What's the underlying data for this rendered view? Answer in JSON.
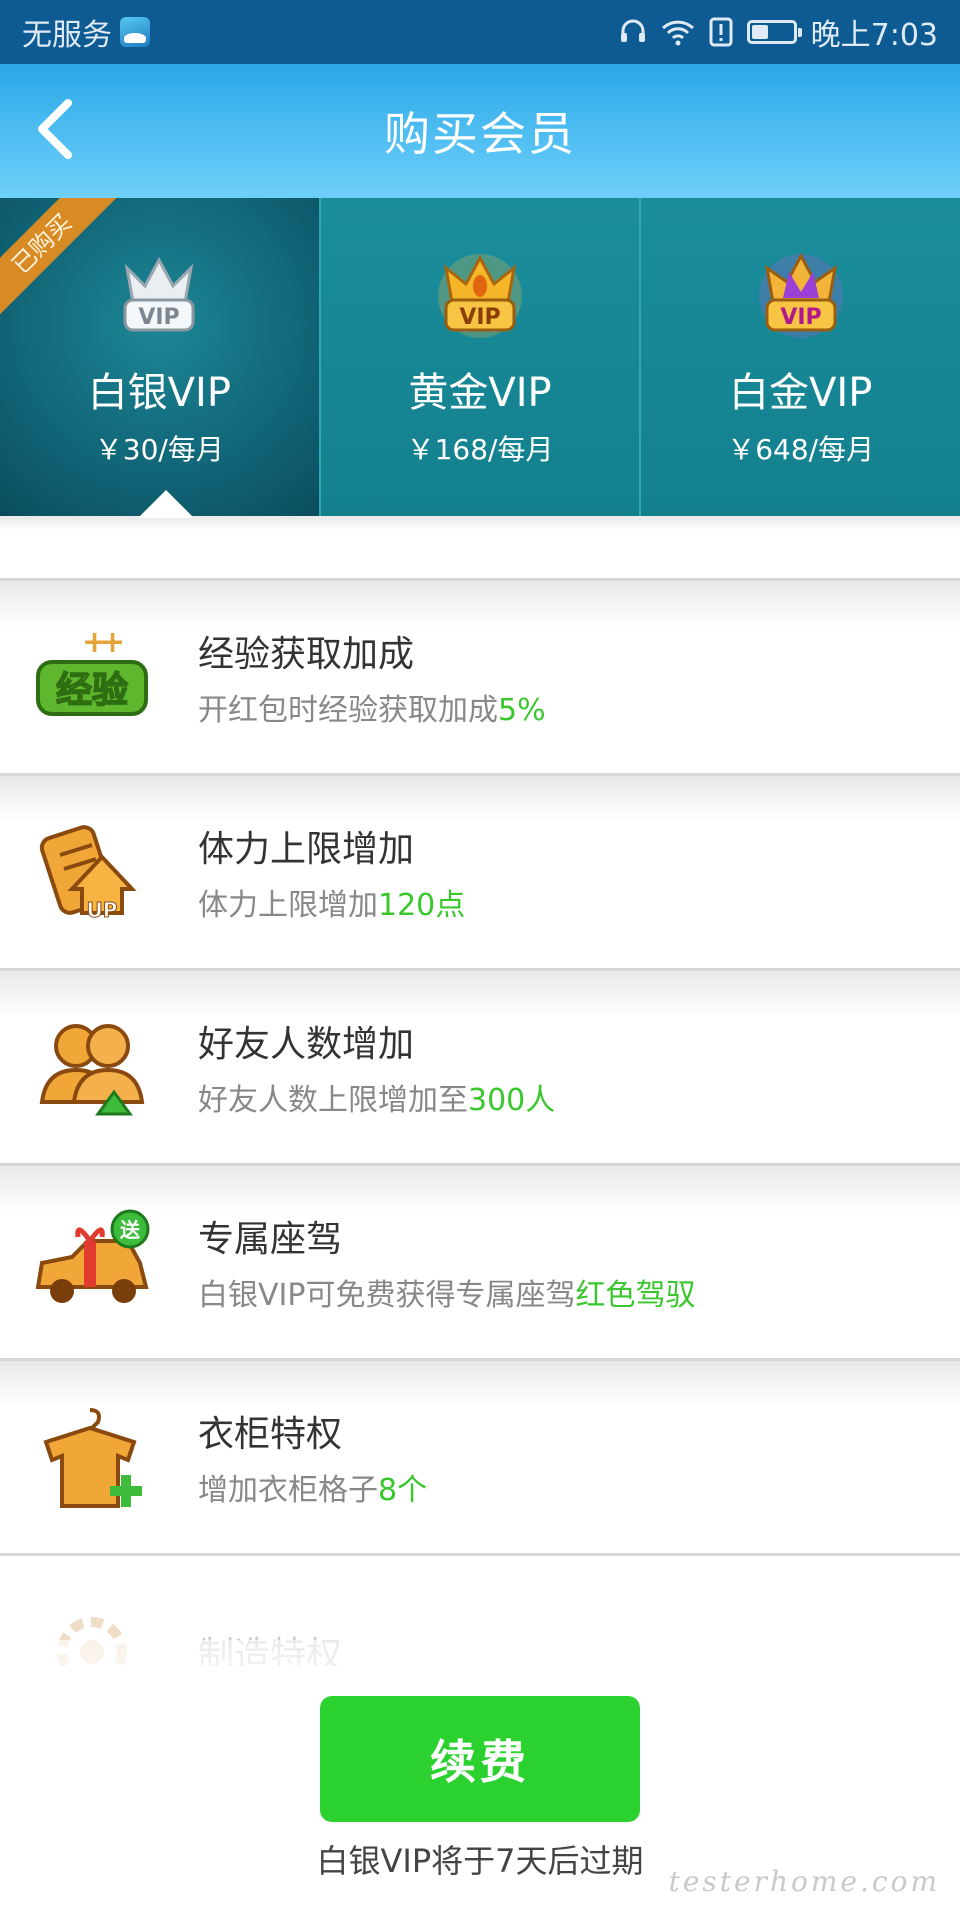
{
  "status_bar": {
    "carrier": "无服务",
    "time": "晚上7:03",
    "icons": [
      "app-icon",
      "headset-icon",
      "wifi-icon",
      "alert-icon",
      "battery-icon"
    ]
  },
  "header": {
    "back_icon": "chevron-left-icon",
    "title": "购买会员"
  },
  "tiers": [
    {
      "name": "白银VIP",
      "price": "￥30/每月",
      "badge": "已购买",
      "selected": true,
      "crown": "silver"
    },
    {
      "name": "黄金VIP",
      "price": "￥168/每月",
      "selected": false,
      "crown": "gold"
    },
    {
      "name": "白金VIP",
      "price": "￥648/每月",
      "selected": false,
      "crown": "platinum"
    }
  ],
  "privileges": [
    {
      "title": "经验获取加成",
      "desc": "开红包时经验获取加成",
      "highlight": "5%",
      "icon": "experience-icon",
      "icon_text": "经验"
    },
    {
      "title": "体力上限增加",
      "desc": "体力上限增加",
      "highlight": "120点",
      "icon": "stamina-up-icon",
      "icon_text": "UP"
    },
    {
      "title": "好友人数增加",
      "desc": "好友人数上限增加至",
      "highlight": "300人",
      "icon": "friends-icon"
    },
    {
      "title": "专属座驾",
      "desc": "白银VIP可免费获得专属座驾",
      "highlight": "红色驾驭",
      "icon": "car-gift-icon",
      "icon_text": "送"
    },
    {
      "title": "衣柜特权",
      "desc": "增加衣柜格子",
      "highlight": "8个",
      "icon": "wardrobe-icon"
    },
    {
      "title": "制造特权",
      "icon": "gear-icon"
    }
  ],
  "footer": {
    "renew_label": "续费",
    "expire_note": "白银VIP将于7天后过期"
  },
  "watermark": "testerhome.com",
  "colors": {
    "status_bar": "#0d5b92",
    "header": "#2aa8e8",
    "tier_bg": "#16808f",
    "highlight": "#39c72d",
    "renew_button": "#2bd12f",
    "badge": "#d88a25"
  }
}
